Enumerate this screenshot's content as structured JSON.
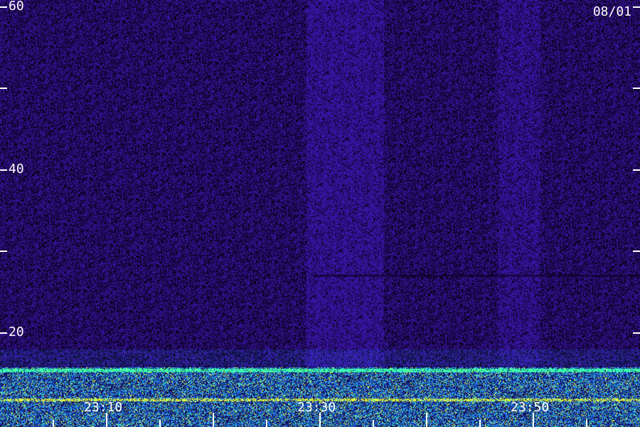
{
  "chart_data": {
    "type": "heatmap",
    "title": "",
    "xlabel": "",
    "ylabel": "",
    "date": "08/01",
    "y_ticks": [
      "60",
      "40",
      "20"
    ],
    "x_ticks": [
      "23:10",
      "23:30",
      "23:50"
    ],
    "ylim": [
      0,
      60
    ],
    "colors": {
      "background": "#1e0646",
      "low": "#3a10a0",
      "mid": "#1e6cff",
      "high": "#40ffd0",
      "peak": "#f0ff40"
    }
  }
}
